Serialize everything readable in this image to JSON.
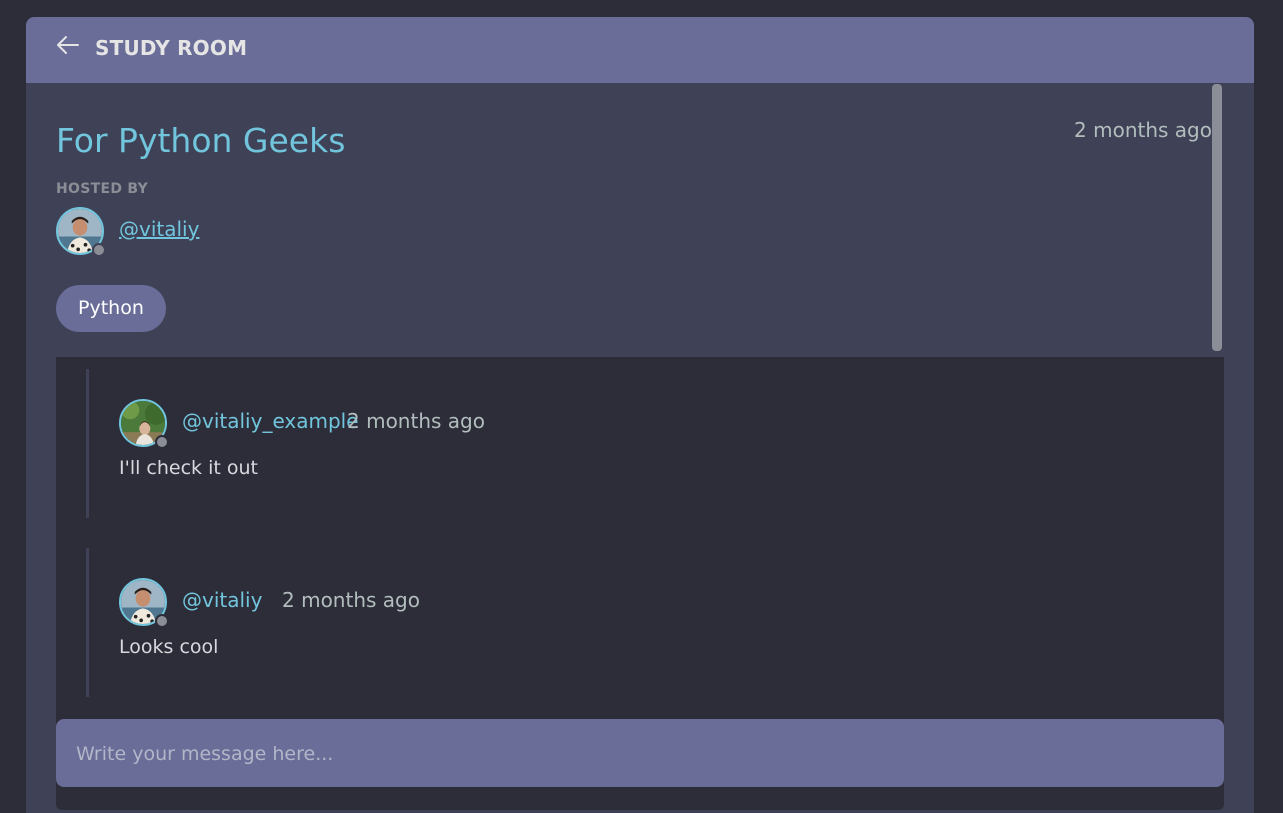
{
  "header": {
    "title": "STUDY ROOM",
    "back_icon": "arrow-left-icon"
  },
  "room": {
    "name": "For Python Geeks",
    "created": "2 months ago",
    "hosted_by_label": "HOSTED BY",
    "host": "@vitaliy",
    "topic": "Python"
  },
  "messages": [
    {
      "author": "@vitaliy_example",
      "time": "2 months ago",
      "body": "I'll check it out"
    },
    {
      "author": "@vitaliy",
      "time": "2 months ago",
      "body": "Looks cool"
    }
  ],
  "composer": {
    "placeholder": "Write your message here..."
  },
  "colors": {
    "page_bg": "#2d2d39",
    "panel_bg": "#3f4156",
    "header_bg": "#696d97",
    "accent": "#71c6dd",
    "muted": "#b2bdbd"
  }
}
